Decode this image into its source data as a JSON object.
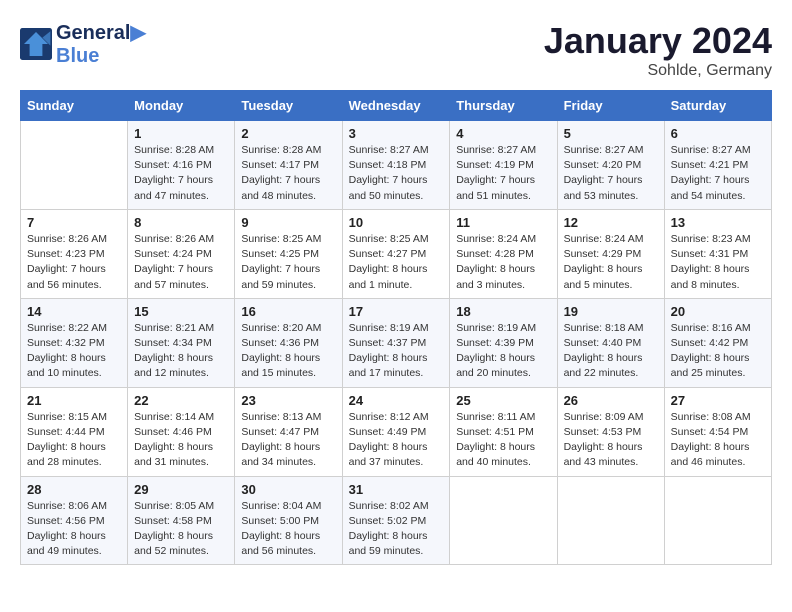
{
  "header": {
    "logo_line1": "General",
    "logo_line2": "Blue",
    "month": "January 2024",
    "location": "Sohlde, Germany"
  },
  "days_of_week": [
    "Sunday",
    "Monday",
    "Tuesday",
    "Wednesday",
    "Thursday",
    "Friday",
    "Saturday"
  ],
  "weeks": [
    [
      {
        "day": "",
        "sunrise": "",
        "sunset": "",
        "daylight": ""
      },
      {
        "day": "1",
        "sunrise": "Sunrise: 8:28 AM",
        "sunset": "Sunset: 4:16 PM",
        "daylight": "Daylight: 7 hours and 47 minutes."
      },
      {
        "day": "2",
        "sunrise": "Sunrise: 8:28 AM",
        "sunset": "Sunset: 4:17 PM",
        "daylight": "Daylight: 7 hours and 48 minutes."
      },
      {
        "day": "3",
        "sunrise": "Sunrise: 8:27 AM",
        "sunset": "Sunset: 4:18 PM",
        "daylight": "Daylight: 7 hours and 50 minutes."
      },
      {
        "day": "4",
        "sunrise": "Sunrise: 8:27 AM",
        "sunset": "Sunset: 4:19 PM",
        "daylight": "Daylight: 7 hours and 51 minutes."
      },
      {
        "day": "5",
        "sunrise": "Sunrise: 8:27 AM",
        "sunset": "Sunset: 4:20 PM",
        "daylight": "Daylight: 7 hours and 53 minutes."
      },
      {
        "day": "6",
        "sunrise": "Sunrise: 8:27 AM",
        "sunset": "Sunset: 4:21 PM",
        "daylight": "Daylight: 7 hours and 54 minutes."
      }
    ],
    [
      {
        "day": "7",
        "sunrise": "Sunrise: 8:26 AM",
        "sunset": "Sunset: 4:23 PM",
        "daylight": "Daylight: 7 hours and 56 minutes."
      },
      {
        "day": "8",
        "sunrise": "Sunrise: 8:26 AM",
        "sunset": "Sunset: 4:24 PM",
        "daylight": "Daylight: 7 hours and 57 minutes."
      },
      {
        "day": "9",
        "sunrise": "Sunrise: 8:25 AM",
        "sunset": "Sunset: 4:25 PM",
        "daylight": "Daylight: 7 hours and 59 minutes."
      },
      {
        "day": "10",
        "sunrise": "Sunrise: 8:25 AM",
        "sunset": "Sunset: 4:27 PM",
        "daylight": "Daylight: 8 hours and 1 minute."
      },
      {
        "day": "11",
        "sunrise": "Sunrise: 8:24 AM",
        "sunset": "Sunset: 4:28 PM",
        "daylight": "Daylight: 8 hours and 3 minutes."
      },
      {
        "day": "12",
        "sunrise": "Sunrise: 8:24 AM",
        "sunset": "Sunset: 4:29 PM",
        "daylight": "Daylight: 8 hours and 5 minutes."
      },
      {
        "day": "13",
        "sunrise": "Sunrise: 8:23 AM",
        "sunset": "Sunset: 4:31 PM",
        "daylight": "Daylight: 8 hours and 8 minutes."
      }
    ],
    [
      {
        "day": "14",
        "sunrise": "Sunrise: 8:22 AM",
        "sunset": "Sunset: 4:32 PM",
        "daylight": "Daylight: 8 hours and 10 minutes."
      },
      {
        "day": "15",
        "sunrise": "Sunrise: 8:21 AM",
        "sunset": "Sunset: 4:34 PM",
        "daylight": "Daylight: 8 hours and 12 minutes."
      },
      {
        "day": "16",
        "sunrise": "Sunrise: 8:20 AM",
        "sunset": "Sunset: 4:36 PM",
        "daylight": "Daylight: 8 hours and 15 minutes."
      },
      {
        "day": "17",
        "sunrise": "Sunrise: 8:19 AM",
        "sunset": "Sunset: 4:37 PM",
        "daylight": "Daylight: 8 hours and 17 minutes."
      },
      {
        "day": "18",
        "sunrise": "Sunrise: 8:19 AM",
        "sunset": "Sunset: 4:39 PM",
        "daylight": "Daylight: 8 hours and 20 minutes."
      },
      {
        "day": "19",
        "sunrise": "Sunrise: 8:18 AM",
        "sunset": "Sunset: 4:40 PM",
        "daylight": "Daylight: 8 hours and 22 minutes."
      },
      {
        "day": "20",
        "sunrise": "Sunrise: 8:16 AM",
        "sunset": "Sunset: 4:42 PM",
        "daylight": "Daylight: 8 hours and 25 minutes."
      }
    ],
    [
      {
        "day": "21",
        "sunrise": "Sunrise: 8:15 AM",
        "sunset": "Sunset: 4:44 PM",
        "daylight": "Daylight: 8 hours and 28 minutes."
      },
      {
        "day": "22",
        "sunrise": "Sunrise: 8:14 AM",
        "sunset": "Sunset: 4:46 PM",
        "daylight": "Daylight: 8 hours and 31 minutes."
      },
      {
        "day": "23",
        "sunrise": "Sunrise: 8:13 AM",
        "sunset": "Sunset: 4:47 PM",
        "daylight": "Daylight: 8 hours and 34 minutes."
      },
      {
        "day": "24",
        "sunrise": "Sunrise: 8:12 AM",
        "sunset": "Sunset: 4:49 PM",
        "daylight": "Daylight: 8 hours and 37 minutes."
      },
      {
        "day": "25",
        "sunrise": "Sunrise: 8:11 AM",
        "sunset": "Sunset: 4:51 PM",
        "daylight": "Daylight: 8 hours and 40 minutes."
      },
      {
        "day": "26",
        "sunrise": "Sunrise: 8:09 AM",
        "sunset": "Sunset: 4:53 PM",
        "daylight": "Daylight: 8 hours and 43 minutes."
      },
      {
        "day": "27",
        "sunrise": "Sunrise: 8:08 AM",
        "sunset": "Sunset: 4:54 PM",
        "daylight": "Daylight: 8 hours and 46 minutes."
      }
    ],
    [
      {
        "day": "28",
        "sunrise": "Sunrise: 8:06 AM",
        "sunset": "Sunset: 4:56 PM",
        "daylight": "Daylight: 8 hours and 49 minutes."
      },
      {
        "day": "29",
        "sunrise": "Sunrise: 8:05 AM",
        "sunset": "Sunset: 4:58 PM",
        "daylight": "Daylight: 8 hours and 52 minutes."
      },
      {
        "day": "30",
        "sunrise": "Sunrise: 8:04 AM",
        "sunset": "Sunset: 5:00 PM",
        "daylight": "Daylight: 8 hours and 56 minutes."
      },
      {
        "day": "31",
        "sunrise": "Sunrise: 8:02 AM",
        "sunset": "Sunset: 5:02 PM",
        "daylight": "Daylight: 8 hours and 59 minutes."
      },
      {
        "day": "",
        "sunrise": "",
        "sunset": "",
        "daylight": ""
      },
      {
        "day": "",
        "sunrise": "",
        "sunset": "",
        "daylight": ""
      },
      {
        "day": "",
        "sunrise": "",
        "sunset": "",
        "daylight": ""
      }
    ]
  ]
}
